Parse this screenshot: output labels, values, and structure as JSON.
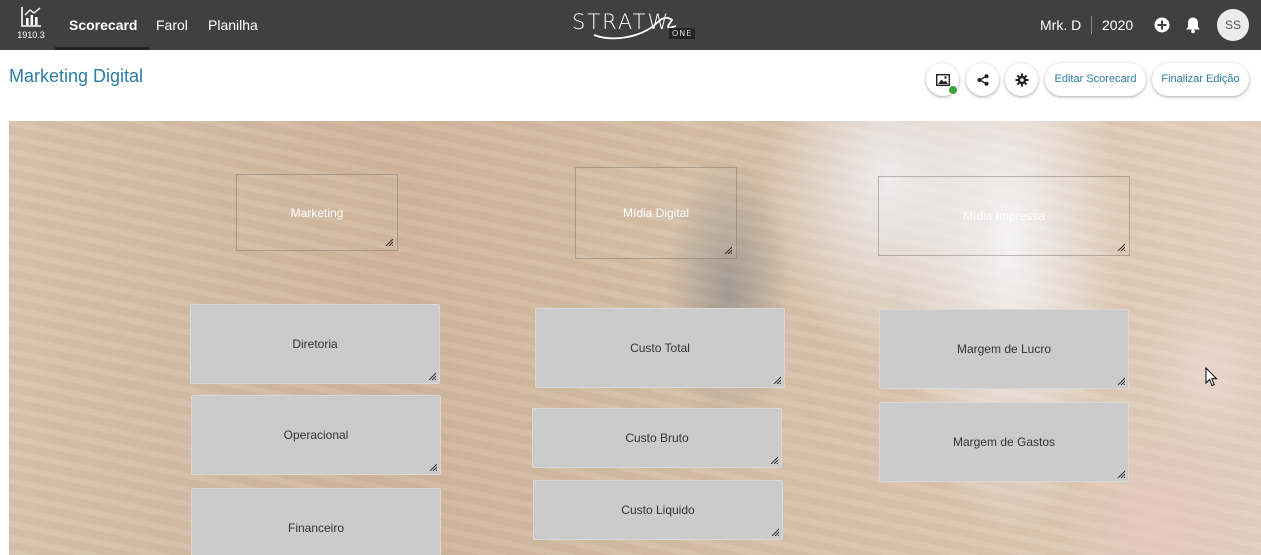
{
  "topbar": {
    "version": "1910.3",
    "nav": [
      {
        "label": "Scorecard",
        "active": true
      },
      {
        "label": "Farol",
        "active": false
      },
      {
        "label": "Planilha",
        "active": false
      }
    ],
    "logo_text": "STRATW",
    "logo_suffix": "ONE",
    "user_label": "Mrk. D",
    "year": "2020",
    "avatar_initials": "SS"
  },
  "page": {
    "title": "Marketing Digital",
    "toolbar": {
      "image_status_color": "#3ca23c",
      "edit_scorecard": "Editar Scorecard",
      "finish_edit": "Finalizar Edição"
    }
  },
  "scorecard": {
    "columns": [
      {
        "header": "Marketing",
        "items": [
          "Diretoria",
          "Operacional",
          "Financeiro"
        ]
      },
      {
        "header": "Mídia Digital",
        "items": [
          "Custo Total",
          "Custo Bruto",
          "Custo Liquido"
        ]
      },
      {
        "header": "Mídia Impressa",
        "items": [
          "Margem de Lucro",
          "Margem de Gastos"
        ]
      }
    ]
  },
  "colors": {
    "topbar": "#404040",
    "accent": "#2a7ca6",
    "card": "#cbcbcb"
  }
}
